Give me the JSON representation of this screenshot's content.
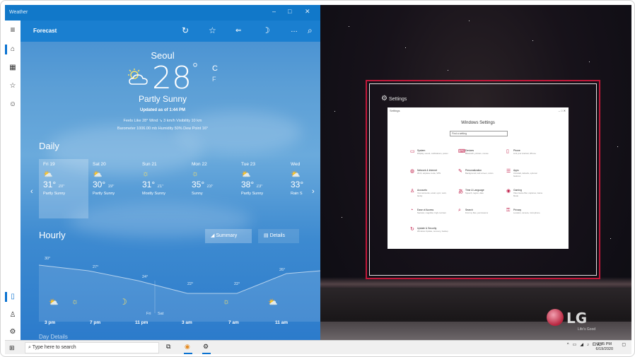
{
  "window": {
    "title": "Weather"
  },
  "toolbar": {
    "title": "Forecast"
  },
  "current": {
    "city": "Seoul",
    "temp": "28",
    "unit_c": "C",
    "unit_f": "F",
    "condition": "Partly Sunny",
    "updated": "Updated as of 1:44 PM",
    "stats_line1": "Feels Like 28°   Wind ↘ 3 km/h   Visibility 10 km",
    "stats_line2": "Barometer 1006.00 mb   Humidity 50%   Dew Point 16°"
  },
  "daily": {
    "heading": "Daily",
    "days": [
      {
        "name": "Fri 19",
        "hi": "31°",
        "lo": "20°",
        "cond": "Partly Sunny"
      },
      {
        "name": "Sat 20",
        "hi": "30°",
        "lo": "19°",
        "cond": "Partly Sunny"
      },
      {
        "name": "Sun 21",
        "hi": "31°",
        "lo": "21°",
        "cond": "Mostly Sunny"
      },
      {
        "name": "Mon 22",
        "hi": "35°",
        "lo": "23°",
        "cond": "Sunny"
      },
      {
        "name": "Tue 23",
        "hi": "38°",
        "lo": "23°",
        "cond": "Partly Sunny"
      },
      {
        "name": "Wed",
        "hi": "33°",
        "lo": "",
        "cond": "Rain S"
      }
    ]
  },
  "hourly": {
    "heading": "Hourly",
    "summary_label": "Summary",
    "details_label": "Details",
    "temps": [
      "30°",
      "27°",
      "24°",
      "22°",
      "22°",
      "26°"
    ],
    "day_labels": [
      "Fri",
      "Sat"
    ],
    "times": [
      "3 pm",
      "7 pm",
      "11 pm",
      "3 am",
      "7 am",
      "11 am"
    ],
    "more_label": "Day Details"
  },
  "desktop": {
    "settings_caption": "Settings",
    "settings_window": {
      "title": "Windows Settings",
      "search_placeholder": "Find a setting",
      "items": [
        {
          "name": "System",
          "desc": "Display, sound, notifications, power"
        },
        {
          "name": "Devices",
          "desc": "Bluetooth, printers, mouse"
        },
        {
          "name": "Phone",
          "desc": "Link your Android, iPhone"
        },
        {
          "name": "Network & Internet",
          "desc": "Wi-Fi, airplane mode, VPN"
        },
        {
          "name": "Personalization",
          "desc": "Background, lock screen, colors"
        },
        {
          "name": "Apps",
          "desc": "Uninstall, defaults, optional features"
        },
        {
          "name": "Accounts",
          "desc": "Your accounts, email, sync, work, family"
        },
        {
          "name": "Time & Language",
          "desc": "Speech, region, date"
        },
        {
          "name": "Gaming",
          "desc": "Xbox Game Bar, captures, Game Mode"
        },
        {
          "name": "Ease of Access",
          "desc": "Narrator, magnifier, high contrast"
        },
        {
          "name": "Search",
          "desc": "Find my files, permissions"
        },
        {
          "name": "Privacy",
          "desc": "Location, camera, microphone"
        },
        {
          "name": "Update & Security",
          "desc": "Windows Update, recovery, backup"
        }
      ]
    },
    "brand": {
      "word": "LG",
      "tagline": "Life's Good"
    }
  },
  "taskbar": {
    "search_placeholder": "Type here to search",
    "lang": "ENG",
    "time": "1:45 PM",
    "date": "6/19/2020"
  },
  "colors": {
    "weather_accent": "#1178c9",
    "task_view_outline": "#c2183a"
  }
}
